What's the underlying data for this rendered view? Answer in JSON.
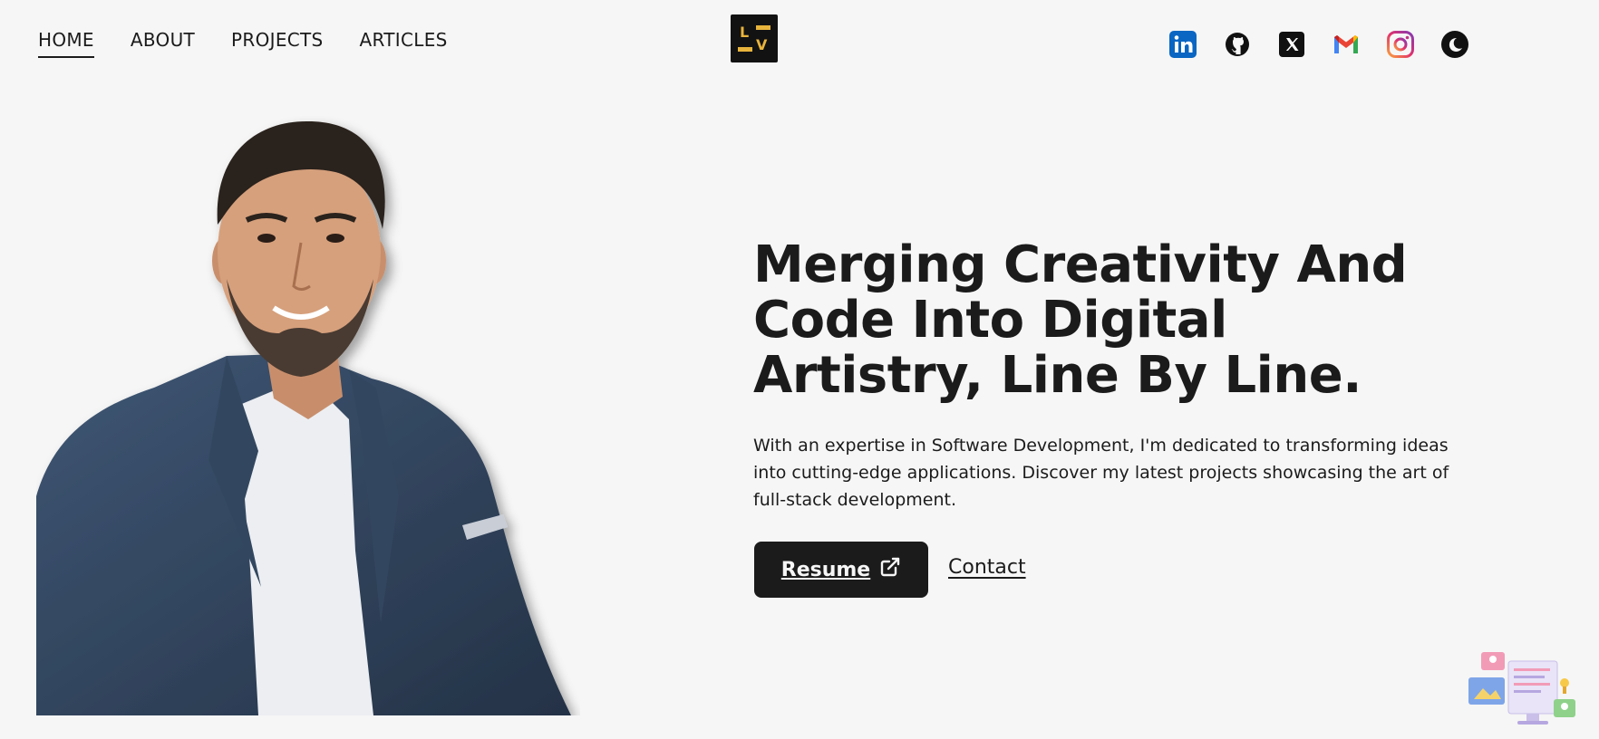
{
  "nav": {
    "items": [
      {
        "label": "HOME",
        "active": true
      },
      {
        "label": "ABOUT",
        "active": false
      },
      {
        "label": "PROJECTS",
        "active": false
      },
      {
        "label": "ARTICLES",
        "active": false
      }
    ]
  },
  "logo": {
    "text_top": "L",
    "text_bottom": "V"
  },
  "social": {
    "icons": [
      "linkedin-icon",
      "github-icon",
      "x-twitter-icon",
      "gmail-icon",
      "instagram-icon",
      "dark-mode-moon-icon"
    ]
  },
  "hero": {
    "headline": "Merging Creativity And Code Into Digital Artistry, Line By Line.",
    "description": "With an expertise in Software Development, I'm dedicated to transforming ideas into cutting-edge applications. Discover my latest projects showcasing the art of full-stack development.",
    "resume_label": "Resume",
    "contact_label": "Contact"
  },
  "colors": {
    "background": "#f6f6f6",
    "text": "#1b1b1b",
    "logo_accent": "#e8b43c"
  }
}
